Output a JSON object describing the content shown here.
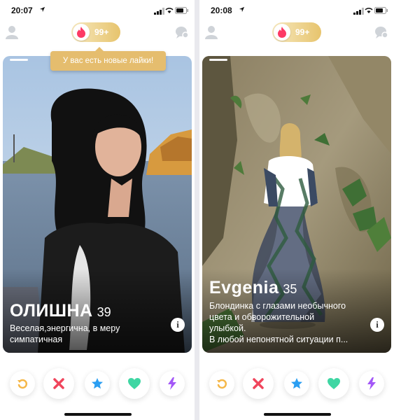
{
  "colors": {
    "gold": "#e5bd6e",
    "flame": "#fd3a64",
    "rewind": "#f5b748",
    "nope": "#f0455c",
    "superlike": "#2a9ef2",
    "like": "#3fd6a3",
    "boost": "#a357f7"
  },
  "screens": [
    {
      "status_time": "20:07",
      "likes_count": "99+",
      "tooltip": "У вас есть новые лайки!",
      "profile": {
        "name": "ОЛИШНА",
        "age": "39",
        "bio": [
          "Веселая,энергична, в меру",
          "симпатичная"
        ]
      }
    },
    {
      "status_time": "20:08",
      "likes_count": "99+",
      "profile": {
        "name": "Evgenia",
        "age": "35",
        "bio": [
          "Блондинка с глазами необычного",
          "цвета и обворожительной",
          "улыбкой.",
          "В любой непонятной ситуации п..."
        ]
      }
    }
  ],
  "info_label": "i",
  "icons": {
    "status": [
      "location-arrow-icon",
      "cellular-signal-icon",
      "wifi-icon",
      "battery-icon"
    ],
    "topbar": [
      "profile-icon",
      "tinder-flame-icon",
      "chat-bubbles-icon"
    ],
    "actions": [
      "rewind-icon",
      "nope-x-icon",
      "super-like-star-icon",
      "like-heart-icon",
      "boost-bolt-icon"
    ]
  }
}
